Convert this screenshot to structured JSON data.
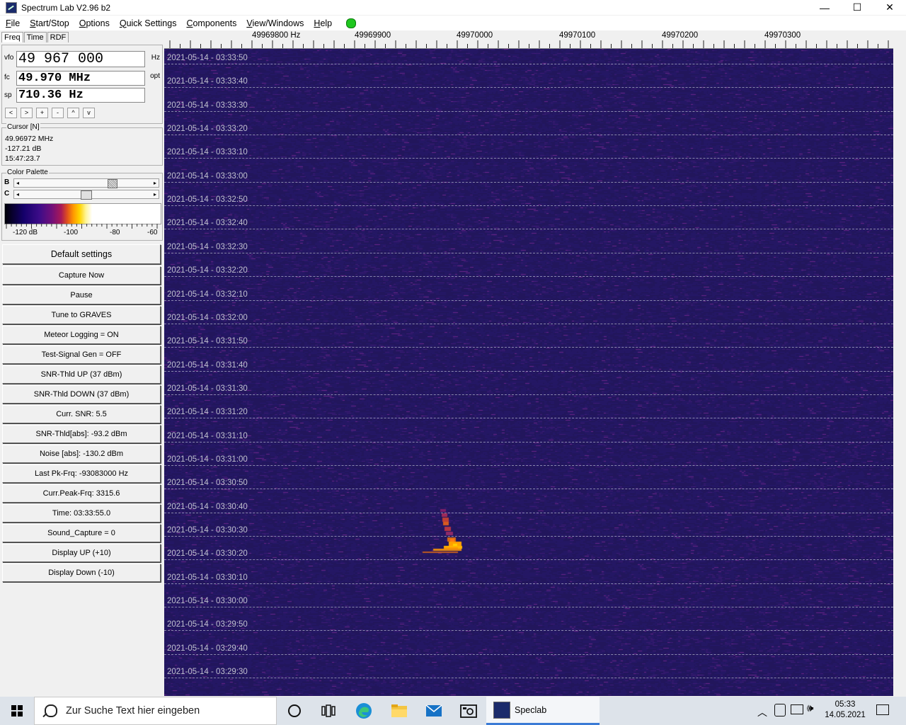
{
  "window": {
    "title": "Spectrum Lab V2.96 b2",
    "controls": [
      "—",
      "☐",
      "✕"
    ]
  },
  "menu": [
    {
      "label": "File",
      "ul": 0
    },
    {
      "label": "Start/Stop",
      "ul": 0
    },
    {
      "label": "Options",
      "ul": 0
    },
    {
      "label": "Quick Settings",
      "ul": 0
    },
    {
      "label": "Components",
      "ul": 0
    },
    {
      "label": "View/Windows",
      "ul": 0
    },
    {
      "label": "Help",
      "ul": 0
    }
  ],
  "tabs": [
    "Freq",
    "Time",
    "RDF"
  ],
  "freq": {
    "vfo_label": "vfo",
    "vfo_value": "49 967 000",
    "vfo_unit": "Hz",
    "fc_label": "fc",
    "fc_value": "49.970 MHz",
    "fc_unit": "opt",
    "sp_label": "sp",
    "sp_value": "710.36 Hz",
    "buttons": [
      "<",
      ">",
      "+",
      "-",
      "^",
      "v"
    ]
  },
  "cursor": {
    "title": "Cursor [N]",
    "freq": "49.96972 MHz",
    "level": "-127.21 dB",
    "time": "15:47:23.7"
  },
  "palette": {
    "title": "Color Palette",
    "b_label": "B",
    "c_label": "C",
    "scale_labels": [
      "-120 dB",
      "-100",
      "-80",
      "-60"
    ]
  },
  "buttons": [
    "Default settings",
    "Capture Now",
    "Pause",
    "Tune to GRAVES",
    "Meteor Logging = ON",
    "Test-Signal Gen = OFF",
    "SNR-Thld UP (37 dBm)",
    "SNR-Thld DOWN (37 dBm)",
    "Curr. SNR: 5.5",
    "SNR-Thld[abs]: -93.2 dBm",
    "Noise [abs]: -130.2 dBm",
    "Last Pk-Frq: -93083000 Hz",
    "Curr.Peak-Frq: 3315.6",
    "Time:  03:33:55.0",
    "Sound_Capture = 0",
    "Display UP (+10)",
    "Display Down (-10)"
  ],
  "freq_axis": [
    "49969800 Hz",
    "49969900",
    "49970000",
    "49970100",
    "49970200",
    "49970300"
  ],
  "timestamps": [
    "2021-05-14 - 03:33:50",
    "2021-05-14 - 03:33:40",
    "2021-05-14 - 03:33:30",
    "2021-05-14 - 03:33:20",
    "2021-05-14 - 03:33:10",
    "2021-05-14 - 03:33:00",
    "2021-05-14 - 03:32:50",
    "2021-05-14 - 03:32:40",
    "2021-05-14 - 03:32:30",
    "2021-05-14 - 03:32:20",
    "2021-05-14 - 03:32:10",
    "2021-05-14 - 03:32:00",
    "2021-05-14 - 03:31:50",
    "2021-05-14 - 03:31:40",
    "2021-05-14 - 03:31:30",
    "2021-05-14 - 03:31:20",
    "2021-05-14 - 03:31:10",
    "2021-05-14 - 03:31:00",
    "2021-05-14 - 03:30:50",
    "2021-05-14 - 03:30:40",
    "2021-05-14 - 03:30:30",
    "2021-05-14 - 03:30:20",
    "2021-05-14 - 03:30:10",
    "2021-05-14 - 03:30:00",
    "2021-05-14 - 03:29:50",
    "2021-05-14 - 03:29:40",
    "2021-05-14 - 03:29:30"
  ],
  "colors": {
    "waterfall_bg": "#22165c",
    "meteor_core": "#ffa000",
    "status_green": "#1fc71f"
  },
  "taskbar": {
    "search_placeholder": "Zur Suche Text hier eingeben",
    "app_label": "Speclab",
    "clock_time": "05:33",
    "clock_date": "14.05.2021"
  }
}
